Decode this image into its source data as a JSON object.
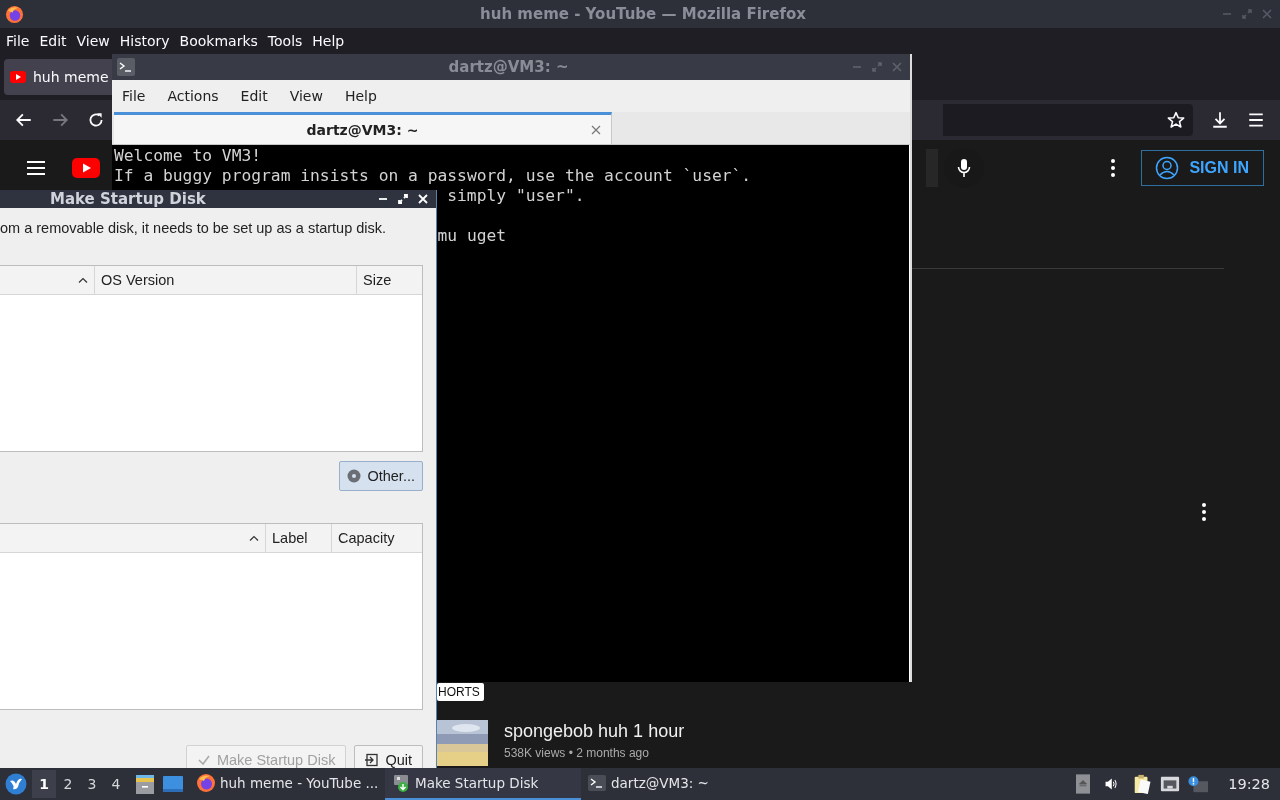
{
  "firefox": {
    "title": "huh meme - YouTube — Mozilla Firefox",
    "menu": [
      "File",
      "Edit",
      "View",
      "History",
      "Bookmarks",
      "Tools",
      "Help"
    ],
    "tab": {
      "label": "huh meme"
    },
    "youtube": {
      "sign_in": "SIGN IN",
      "shorts_label": "HORTS",
      "video": {
        "title": "spongebob huh 1 hour",
        "meta": "538K views • 2 months ago"
      }
    }
  },
  "terminal": {
    "title": "dartz@VM3: ~",
    "menu": [
      "File",
      "Actions",
      "Edit",
      "View",
      "Help"
    ],
    "tab": {
      "label": "dartz@VM3: ~"
    },
    "lines": [
      {
        "kind": "full",
        "text": "Welcome to VM3!"
      },
      {
        "kind": "full",
        "text": "If a buggy program insists on a password, use the account `user`."
      },
      {
        "kind": "partial",
        "text": "simply \"user\"."
      },
      {
        "kind": "blank"
      },
      {
        "kind": "partial",
        "text": "mu uget"
      }
    ]
  },
  "startup_disk": {
    "title": "Make Startup Disk",
    "description": "om a removable disk, it needs to be set up as a startup disk.",
    "source_table": {
      "columns": [
        {
          "sorted": true
        },
        {
          "label": "OS Version",
          "sorted": false
        },
        {
          "label": "Size",
          "sorted": false
        }
      ]
    },
    "other_button": {
      "label": "Other..."
    },
    "disk_table": {
      "columns": [
        {
          "sorted": true
        },
        {
          "label": "Label",
          "sorted": false
        },
        {
          "label": "Capacity",
          "sorted": false
        }
      ]
    },
    "buttons": [
      {
        "kind": "make",
        "label": "Make Startup Disk",
        "disabled": true
      },
      {
        "kind": "quit",
        "label": "Quit",
        "disabled": false
      }
    ]
  },
  "taskbar": {
    "workspaces": [
      {
        "label": "1",
        "selected": true
      },
      {
        "label": "2",
        "selected": false
      },
      {
        "label": "3",
        "selected": false
      },
      {
        "label": "4",
        "selected": false
      }
    ],
    "tasks": [
      {
        "kind": "browser",
        "label": "huh meme - YouTube ...",
        "selected": false
      },
      {
        "kind": "disk",
        "label": "Make Startup Disk",
        "selected": true
      },
      {
        "kind": "terminal",
        "label": "dartz@VM3: ~",
        "selected": false
      }
    ],
    "clock": "19:28"
  }
}
